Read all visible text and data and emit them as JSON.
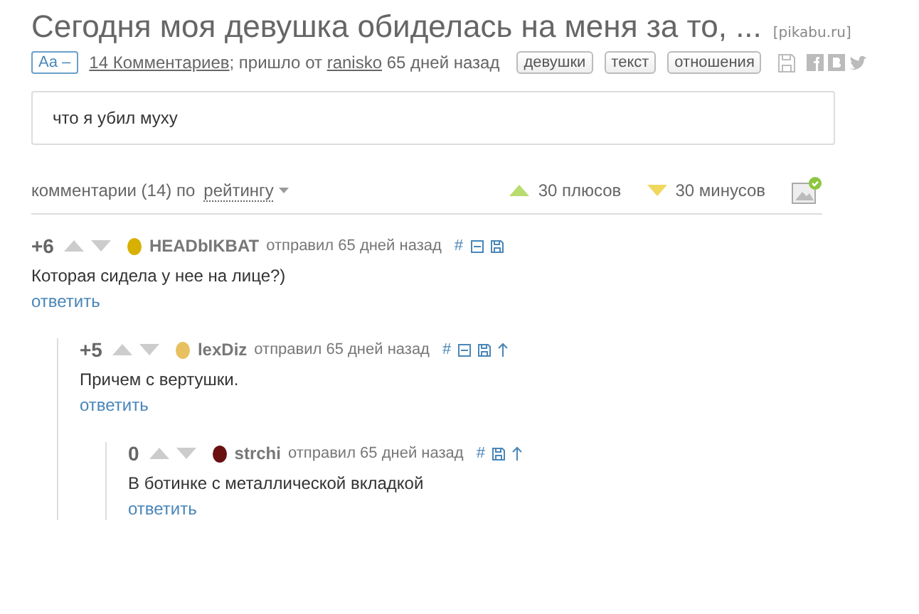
{
  "title": "Сегодня моя девушка обиделась на меня за то, ...",
  "source": "[pikabu.ru]",
  "meta": {
    "font_toggle": "Aa –",
    "comments_link": "14 Комментариев",
    "sent_by": "; пришло от",
    "author": "ranisko",
    "age": "65 дней назад",
    "tags": [
      "девушки",
      "текст",
      "отношения"
    ]
  },
  "body": "что я убил муху",
  "comments_bar": {
    "label": "комментарии (14) по",
    "sort": "рейтингу",
    "pluses": "30 плюсов",
    "minuses": "30 минусов"
  },
  "comments": [
    {
      "score": "+6",
      "user": "HEADbIKBAT",
      "sent": "отправил 65 дней назад",
      "text": "Которая сидела у нее на лице?)",
      "reply": "ответить",
      "actions": [
        {
          "kind": "text",
          "label": "#"
        },
        {
          "kind": "collapse"
        },
        {
          "kind": "save"
        }
      ],
      "children": [
        {
          "score": "+5",
          "user": "lexDiz",
          "sent": "отправил 65 дней назад",
          "text": "Причем с вертушки.",
          "reply": "ответить",
          "actions": [
            {
              "kind": "text",
              "label": "#"
            },
            {
              "kind": "collapse"
            },
            {
              "kind": "save"
            },
            {
              "kind": "parent"
            }
          ],
          "children": [
            {
              "score": "0",
              "user": "strchi",
              "sent": "отправил 65 дней назад",
              "text": "В ботинке с металлической вкладкой",
              "reply": "ответить",
              "actions": [
                {
                  "kind": "text",
                  "label": "#"
                },
                {
                  "kind": "save"
                },
                {
                  "kind": "parent"
                }
              ]
            }
          ]
        }
      ]
    }
  ]
}
